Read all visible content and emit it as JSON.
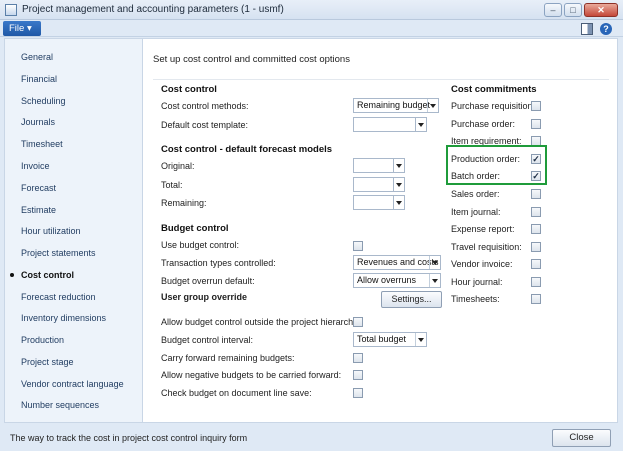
{
  "window": {
    "title": "Project management and accounting parameters (1 - usmf)",
    "minimize_glyph": "–",
    "maximize_glyph": "□",
    "close_glyph": "✕"
  },
  "menubar": {
    "file_label": "File",
    "file_arrow": "▾",
    "icons": [
      "layout-icon",
      "help-icon"
    ],
    "help_glyph": "?"
  },
  "sidebar": {
    "items": [
      {
        "label": "General"
      },
      {
        "label": "Financial"
      },
      {
        "label": "Scheduling"
      },
      {
        "label": "Journals"
      },
      {
        "label": "Timesheet"
      },
      {
        "label": "Invoice"
      },
      {
        "label": "Forecast"
      },
      {
        "label": "Estimate"
      },
      {
        "label": "Hour utilization"
      },
      {
        "label": "Project statements"
      },
      {
        "label": "Cost control"
      },
      {
        "label": "Forecast reduction"
      },
      {
        "label": "Inventory dimensions"
      },
      {
        "label": "Production"
      },
      {
        "label": "Project stage"
      },
      {
        "label": "Vendor contract language"
      },
      {
        "label": "Number sequences"
      }
    ],
    "active_index": 10
  },
  "content": {
    "header": "Set up cost control and committed cost options",
    "cost_control": {
      "title": "Cost control",
      "methods_label": "Cost control methods:",
      "methods_value": "Remaining budget",
      "template_label": "Default cost template:",
      "template_value": ""
    },
    "forecast_models": {
      "title": "Cost control - default forecast models",
      "original_label": "Original:",
      "original_value": "",
      "total_label": "Total:",
      "total_value": "",
      "remaining_label": "Remaining:",
      "remaining_value": ""
    },
    "budget_control": {
      "title": "Budget control",
      "use_label": "Use budget control:",
      "use_checked": false,
      "transaction_label": "Transaction types controlled:",
      "transaction_value": "Revenues and costs",
      "overrun_label": "Budget overrun default:",
      "overrun_value": "Allow overruns",
      "user_group_label": "User group override",
      "settings_button": "Settings...",
      "outside_label": "Allow budget control outside the project hierarchy:",
      "outside_checked": false,
      "interval_label": "Budget control interval:",
      "interval_value": "Total budget",
      "carry_label": "Carry forward remaining budgets:",
      "carry_checked": false,
      "negative_label": "Allow negative budgets to be carried forward:",
      "negative_checked": false,
      "check_label": "Check budget on document line save:",
      "check_checked": false
    },
    "commitments": {
      "title": "Cost commitments",
      "items": [
        {
          "label": "Purchase requisition:",
          "checked": false
        },
        {
          "label": "Purchase order:",
          "checked": false
        },
        {
          "label": "Item requirement:",
          "checked": false
        },
        {
          "label": "Production order:",
          "checked": true
        },
        {
          "label": "Batch order:",
          "checked": true
        },
        {
          "label": "Sales order:",
          "checked": false
        },
        {
          "label": "Item journal:",
          "checked": false
        },
        {
          "label": "Expense report:",
          "checked": false
        },
        {
          "label": "Travel requisition:",
          "checked": false
        },
        {
          "label": "Vendor invoice:",
          "checked": false
        },
        {
          "label": "Hour journal:",
          "checked": false
        },
        {
          "label": "Timesheets:",
          "checked": false
        }
      ],
      "highlight_color": "#1f9b3a"
    },
    "check_glyph": "✓"
  },
  "statusbar": {
    "text": "The way to track the cost in project cost control inquiry form",
    "close_button": "Close"
  }
}
